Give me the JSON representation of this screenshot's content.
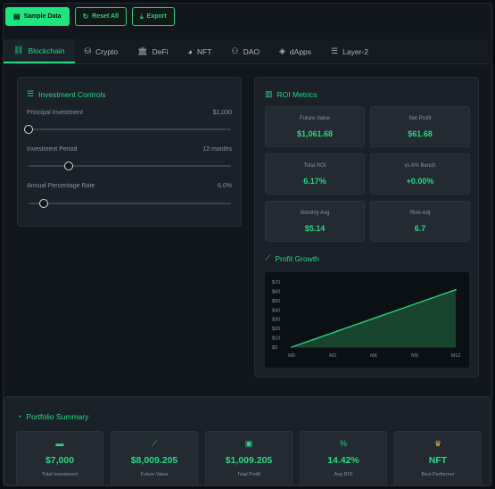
{
  "toolbar": {
    "sample_label": "Sample Data",
    "reset_label": "Reset All",
    "export_label": "Export"
  },
  "tabs": [
    {
      "label": "Blockchain",
      "icon": "link-icon",
      "active": true
    },
    {
      "label": "Crypto",
      "icon": "coins-icon"
    },
    {
      "label": "DeFi",
      "icon": "bank-icon"
    },
    {
      "label": "NFT",
      "icon": "palette-icon"
    },
    {
      "label": "DAO",
      "icon": "users-icon"
    },
    {
      "label": "dApps",
      "icon": "cube-icon"
    },
    {
      "label": "Layer-2",
      "icon": "layers-icon"
    }
  ],
  "controls": {
    "title": "Investment Controls",
    "principal": {
      "label": "Principal Investment",
      "value": "$1,000",
      "level": 0.0
    },
    "period": {
      "label": "Investment Period",
      "value": "12 months",
      "level": 0.2
    },
    "apr": {
      "label": "Annual Percentage Rate",
      "value": "6.0%",
      "level": 0.075
    }
  },
  "roi": {
    "title": "ROI Metrics",
    "metrics": [
      {
        "label": "Future Value",
        "value": "$1,061.68"
      },
      {
        "label": "Net Profit",
        "value": "$61.68"
      },
      {
        "label": "Total ROI",
        "value": "6.17%"
      },
      {
        "label": "vs 6% Bench",
        "value": "+0.00%"
      },
      {
        "label": "Monthly Avg",
        "value": "$5.14"
      },
      {
        "label": "Risk-Adj",
        "value": "6.7"
      }
    ]
  },
  "growth": {
    "title": "Profit Growth"
  },
  "chart_data": {
    "type": "area",
    "title": "",
    "xlabel": "",
    "ylabel": "",
    "categories": [
      "M0",
      "M3",
      "M6",
      "M9",
      "M12"
    ],
    "x": [
      0,
      3,
      6,
      9,
      12
    ],
    "values": [
      0,
      15.42,
      30.84,
      46.26,
      61.68
    ],
    "ylim": [
      0,
      70
    ],
    "yticks": [
      "$70",
      "$60",
      "$50",
      "$40",
      "$30",
      "$20",
      "$10",
      "$0"
    ],
    "grid": false,
    "color": "#2ecf7f"
  },
  "summary": {
    "title": "Portfolio Summary",
    "cards": [
      {
        "icon": "wallet-icon",
        "value": "$7,000",
        "label": "Total Investment"
      },
      {
        "icon": "chart-line-icon",
        "value": "$8,009.205",
        "label": "Future Value"
      },
      {
        "icon": "money-icon",
        "value": "$1,009.205",
        "label": "Total Profit"
      },
      {
        "icon": "percent-icon",
        "value": "14.42%",
        "label": "Avg ROI"
      },
      {
        "icon": "trophy-icon",
        "value": "NFT",
        "label": "Best Performer"
      }
    ]
  },
  "colors": {
    "accent": "#27d985",
    "background": "#12171d",
    "panel": "#1b2128",
    "trophy": "#e7b63a"
  }
}
